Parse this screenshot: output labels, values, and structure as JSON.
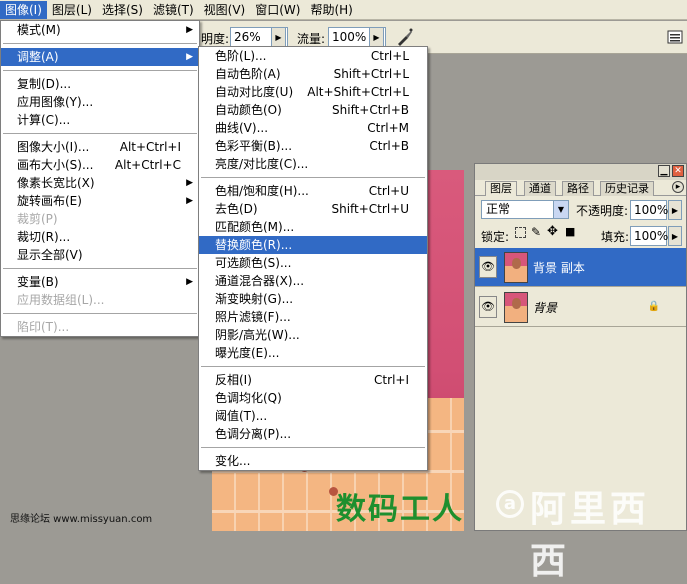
{
  "menubar": {
    "items": [
      {
        "label": "图像(I)",
        "active": true
      },
      {
        "label": "图层(L)"
      },
      {
        "label": "选择(S)"
      },
      {
        "label": "滤镜(T)"
      },
      {
        "label": "视图(V)"
      },
      {
        "label": "窗口(W)"
      },
      {
        "label": "帮助(H)"
      }
    ]
  },
  "options_bar": {
    "opacity_label": "明度:",
    "opacity_value": "26%",
    "flow_label": "流量:",
    "flow_value": "100%"
  },
  "image_menu": {
    "items": [
      {
        "label": "模式(M)",
        "submenu": true
      },
      {
        "sep": true
      },
      {
        "label": "调整(A)",
        "submenu": true,
        "highlight": true
      },
      {
        "sep": true
      },
      {
        "label": "复制(D)..."
      },
      {
        "label": "应用图像(Y)..."
      },
      {
        "label": "计算(C)..."
      },
      {
        "sep": true
      },
      {
        "label": "图像大小(I)...",
        "shortcut": "Alt+Ctrl+I"
      },
      {
        "label": "画布大小(S)...",
        "shortcut": "Alt+Ctrl+C"
      },
      {
        "label": "像素长宽比(X)",
        "submenu": true
      },
      {
        "label": "旋转画布(E)",
        "submenu": true
      },
      {
        "label": "裁剪(P)",
        "disabled": true
      },
      {
        "label": "裁切(R)..."
      },
      {
        "label": "显示全部(V)"
      },
      {
        "sep": true
      },
      {
        "label": "变量(B)",
        "submenu": true
      },
      {
        "label": "应用数据组(L)...",
        "disabled": true
      },
      {
        "sep": true
      },
      {
        "label": "陷印(T)...",
        "disabled": true
      }
    ]
  },
  "adjust_menu": {
    "items": [
      {
        "label": "色阶(L)...",
        "shortcut": "Ctrl+L"
      },
      {
        "label": "自动色阶(A)",
        "shortcut": "Shift+Ctrl+L"
      },
      {
        "label": "自动对比度(U)",
        "shortcut": "Alt+Shift+Ctrl+L"
      },
      {
        "label": "自动颜色(O)",
        "shortcut": "Shift+Ctrl+B"
      },
      {
        "label": "曲线(V)...",
        "shortcut": "Ctrl+M"
      },
      {
        "label": "色彩平衡(B)...",
        "shortcut": "Ctrl+B"
      },
      {
        "label": "亮度/对比度(C)..."
      },
      {
        "sep": true
      },
      {
        "label": "色相/饱和度(H)...",
        "shortcut": "Ctrl+U"
      },
      {
        "label": "去色(D)",
        "shortcut": "Shift+Ctrl+U"
      },
      {
        "label": "匹配颜色(M)..."
      },
      {
        "label": "替换颜色(R)...",
        "highlight": true
      },
      {
        "label": "可选颜色(S)..."
      },
      {
        "label": "通道混合器(X)..."
      },
      {
        "label": "渐变映射(G)..."
      },
      {
        "label": "照片滤镜(F)..."
      },
      {
        "label": "阴影/高光(W)..."
      },
      {
        "label": "曝光度(E)..."
      },
      {
        "sep": true
      },
      {
        "label": "反相(I)",
        "shortcut": "Ctrl+I"
      },
      {
        "label": "色调均化(Q)"
      },
      {
        "label": "阈值(T)..."
      },
      {
        "label": "色调分离(P)..."
      },
      {
        "sep": true
      },
      {
        "label": "变化..."
      }
    ]
  },
  "layers_panel": {
    "tabs": [
      "图层",
      "通道",
      "路径",
      "历史记录"
    ],
    "blend_mode": "正常",
    "opacity_label": "不透明度:",
    "opacity_value": "100%",
    "lock_label": "锁定:",
    "fill_label": "填充:",
    "fill_value": "100%",
    "layers": [
      {
        "name": "背景 副本",
        "selected": true
      },
      {
        "name": "背景",
        "locked": true
      }
    ]
  },
  "watermarks": {
    "canvas_text": "数码工人",
    "logo_text": "阿里西西",
    "footer_text": "思缘论坛 www.missyuan.com"
  },
  "colors": {
    "menu_highlight": "#316ac5",
    "canvas_bg": "#d24f74"
  }
}
